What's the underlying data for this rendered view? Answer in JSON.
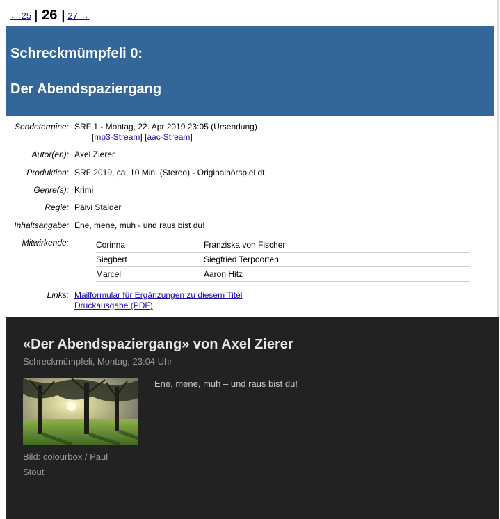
{
  "pager": {
    "prev": "← 25",
    "current": "26",
    "next": "27 →",
    "sep": "|"
  },
  "banner": {
    "line1": "Schreckmümpfeli 0:",
    "line2": "Der Abendspaziergang"
  },
  "details": {
    "sendetermine_label": "Sendetermine:",
    "sendetermine_value": "SRF 1 - Montag, 22. Apr 2019 23:05 (Ursendung)",
    "mp3_stream": "mp3-Stream",
    "aac_stream": "aac-Stream",
    "autor_label": "Autor(en):",
    "autor_value": "Axel Zierer",
    "produktion_label": "Produktion:",
    "produktion_value": "SRF 2019, ca. 10 Min. (Stereo) - Originalhörspiel dt.",
    "genre_label": "Genre(s):",
    "genre_value": "Krimi",
    "regie_label": "Regie:",
    "regie_value": "Päivi Stalder",
    "inhalt_label": "Inhaltsangabe:",
    "inhalt_value": "Ene, mene, muh - und raus bist du!",
    "mitwirkende_label": "Mitwirkende:",
    "cast": [
      {
        "role": "Corinna",
        "actor": "Franziska von Fischer"
      },
      {
        "role": "Siegbert",
        "actor": "Siegfried Terpoorten"
      },
      {
        "role": "Marcel",
        "actor": "Aaron Hitz"
      }
    ],
    "links_label": "Links:",
    "link_mailformular": "Mailformular für Ergänzungen zu diesem Titel",
    "link_druckausgabe": "Druckausgabe (PDF)"
  },
  "player": {
    "title": "«Der Abendspaziergang» von Axel Zierer",
    "subtitle": "Schreckmümpfeli, Montag, 23:04 Uhr",
    "caption_line1": "Bild: colourbox / Paul",
    "caption_line2": "Stout",
    "teaser": "Ene, mene, muh – und raus bist du!"
  },
  "colors": {
    "banner": "#336699",
    "link": "#1a0dab",
    "dark_bg": "#222222"
  }
}
